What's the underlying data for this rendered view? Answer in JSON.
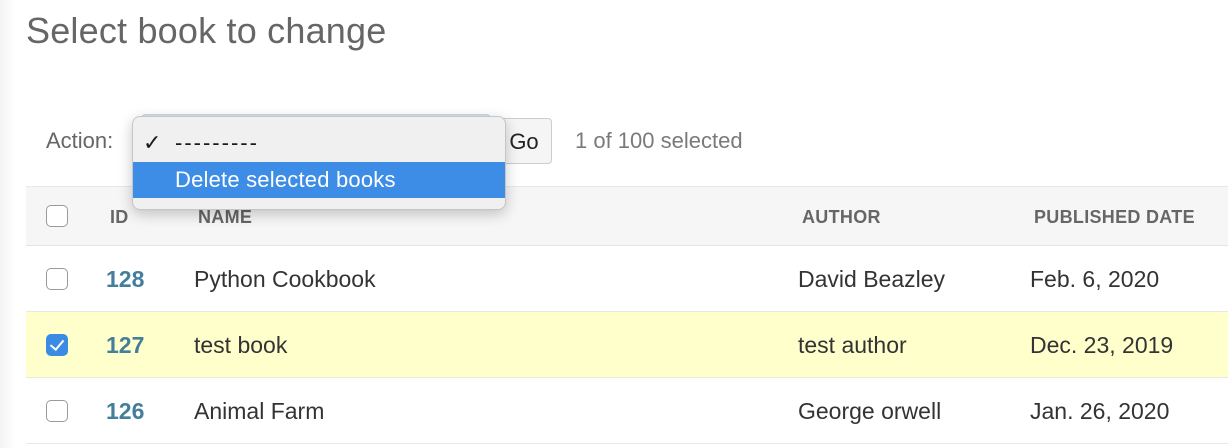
{
  "page": {
    "title": "Select book to change"
  },
  "actions": {
    "label": "Action:",
    "options": [
      {
        "label": "---------",
        "checked": true,
        "highlighted": false
      },
      {
        "label": "Delete selected books",
        "checked": false,
        "highlighted": true
      }
    ],
    "check_glyph": "✓",
    "go_label": "Go",
    "selection_status": "1 of 100 selected"
  },
  "table": {
    "headers": {
      "id": "ID",
      "name": "NAME",
      "author": "AUTHOR",
      "published_date": "PUBLISHED DATE"
    },
    "rows": [
      {
        "id": "128",
        "name": "Python Cookbook",
        "author": "David Beazley",
        "published_date": "Feb. 6, 2020",
        "selected": false
      },
      {
        "id": "127",
        "name": "test book",
        "author": "test author",
        "published_date": "Dec. 23, 2019",
        "selected": true
      },
      {
        "id": "126",
        "name": "Animal Farm",
        "author": "George orwell",
        "published_date": "Jan. 26, 2020",
        "selected": false
      }
    ]
  },
  "colors": {
    "link": "#447e9b",
    "selected_row": "#ffffcc",
    "dropdown_highlight": "#3d8de6",
    "checkbox_checked": "#3b8be4"
  }
}
